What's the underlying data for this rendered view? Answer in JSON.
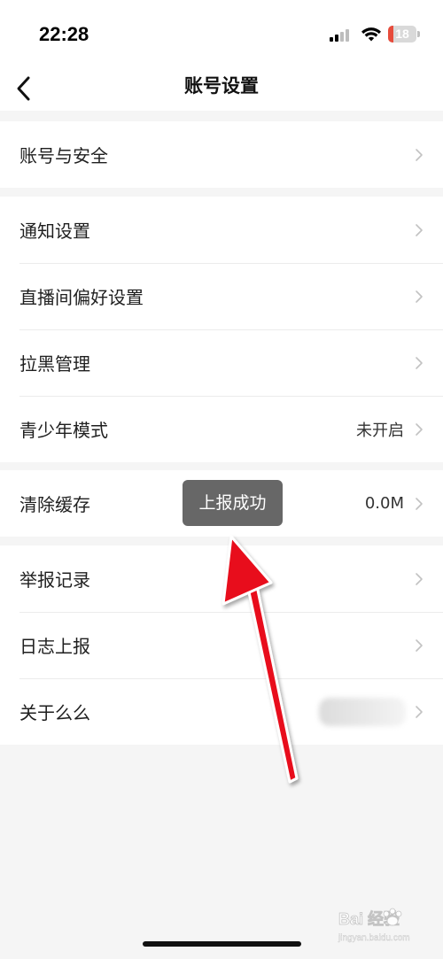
{
  "status_bar": {
    "time": "22:28",
    "battery_level": "18",
    "signal_icon": "cellular-signal-icon",
    "wifi_icon": "wifi-icon",
    "battery_icon": "battery-icon",
    "battery_color": "#e74c3c"
  },
  "header": {
    "title": "账号设置",
    "back_icon": "chevron-left-icon"
  },
  "groups": [
    {
      "items": [
        {
          "label": "账号与安全",
          "value": ""
        }
      ]
    },
    {
      "items": [
        {
          "label": "通知设置",
          "value": ""
        },
        {
          "label": "直播间偏好设置",
          "value": ""
        },
        {
          "label": "拉黑管理",
          "value": ""
        },
        {
          "label": "青少年模式",
          "value": "未开启"
        }
      ]
    },
    {
      "items": [
        {
          "label": "清除缓存",
          "value": "0.0M"
        }
      ]
    },
    {
      "items": [
        {
          "label": "举报记录",
          "value": ""
        },
        {
          "label": "日志上报",
          "value": ""
        },
        {
          "label": "关于么么",
          "value": ""
        }
      ]
    }
  ],
  "toast": {
    "text": "上报成功"
  },
  "annotation": {
    "arrow_color": "#e8111b",
    "arrow_icon": "red-annotation-arrow"
  },
  "watermark": {
    "text": "Bai 经验",
    "sub_text": "jingyan.baidu.com"
  },
  "colors": {
    "background": "#f5f5f5",
    "card": "#ffffff",
    "toast_bg": "#676767",
    "chevron": "#c2c2c2"
  }
}
